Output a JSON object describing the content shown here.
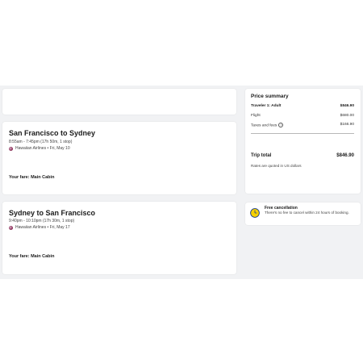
{
  "flights": [
    {
      "title": "San Francisco to Sydney",
      "times": "8:55am - 7:45pm (17h 50m, 1 stop)",
      "airline": "Hawaiian Airlines • Fri, May 10",
      "fare": "Your fare: Main Cabin"
    },
    {
      "title": "Sydney to San Francisco",
      "times": "9:40pm - 10:10pm (17h 30m, 1 stop)",
      "airline": "Hawaiian Airlines • Fri, May 17",
      "fare": "Your fare: Main Cabin"
    }
  ],
  "summary": {
    "title": "Price summary",
    "traveler_label": "Traveler 1: Adult",
    "traveler_amount": "$846.90",
    "flight_label": "Flight",
    "flight_amount": "$680.00",
    "taxes_label": "Taxes and fees",
    "taxes_info_icon": "i",
    "taxes_amount": "$166.90",
    "total_label": "Trip total",
    "total_amount": "$846.90",
    "note": "Rates are quoted in US dollars"
  },
  "cancellation": {
    "title": "Free cancellation",
    "text": "There's no fee to cancel within 24 hours of booking.",
    "icon": "clock-icon"
  },
  "colors": {
    "panel_background": "#f1f2f4",
    "clock_yellow": "#f5d000",
    "clock_blue": "#1b3c8c",
    "airline_logo": "#8a2a55"
  }
}
